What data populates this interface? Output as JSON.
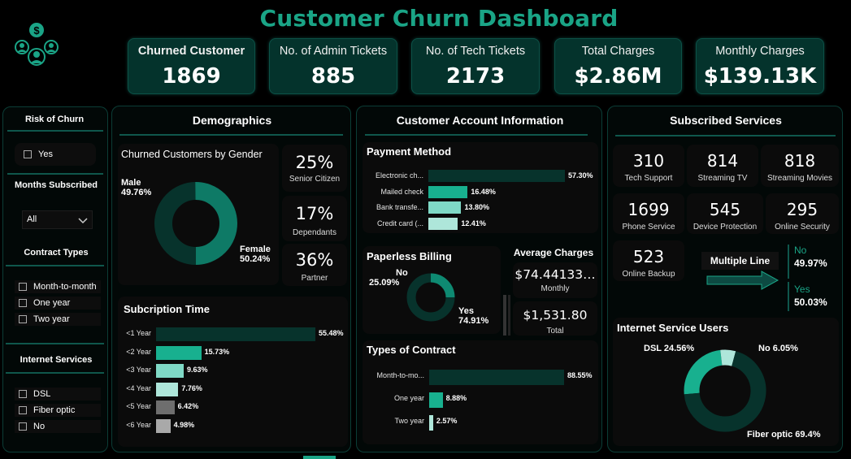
{
  "title": "Customer Churn Dashboard",
  "kpis": [
    {
      "label": "Churned Customer",
      "value": "1869"
    },
    {
      "label": "No. of Admin Tickets",
      "value": "885"
    },
    {
      "label": "No. of Tech Tickets",
      "value": "2173"
    },
    {
      "label": "Total Charges",
      "value": "$2.86M"
    },
    {
      "label": "Monthly Charges",
      "value": "$139.13K"
    }
  ],
  "filters": {
    "risk_label": "Risk of Churn",
    "risk_option": "Yes",
    "months_label": "Months Subscribed",
    "months_value": "All",
    "contract_label": "Contract Types",
    "contract_options": [
      "Month-to-month",
      "One year",
      "Two year"
    ],
    "internet_label": "Internet Services",
    "internet_options": [
      "DSL",
      "Fiber optic",
      "No"
    ]
  },
  "demographics": {
    "title": "Demographics",
    "gender_title": "Churned Customers by Gender",
    "male_label": "Male",
    "male_pct": "49.76%",
    "female_label": "Female",
    "female_pct": "50.24%",
    "stats": [
      {
        "value": "25%",
        "label": "Senior Citizen"
      },
      {
        "value": "17%",
        "label": "Dependants"
      },
      {
        "value": "36%",
        "label": "Partner"
      }
    ],
    "sub_title": "Subcription Time"
  },
  "account": {
    "title": "Customer Account Information",
    "payment_title": "Payment Method",
    "paperless_title": "Paperless Billing",
    "paperless_no_label": "No",
    "paperless_no_pct": "25.09%",
    "paperless_yes_label": "Yes",
    "paperless_yes_pct": "74.91%",
    "avg_title": "Average Charges",
    "avg_monthly_value": "$74.44133…",
    "avg_monthly_label": "Monthly",
    "avg_total_value": "$1,531.80",
    "avg_total_label": "Total",
    "contract_title": "Types of Contract"
  },
  "services": {
    "title": "Subscribed Services",
    "tiles": [
      {
        "value": "310",
        "label": "Tech Support"
      },
      {
        "value": "814",
        "label": "Streaming TV"
      },
      {
        "value": "818",
        "label": "Streaming Movies"
      },
      {
        "value": "1699",
        "label": "Phone Service"
      },
      {
        "value": "545",
        "label": "Device Protection"
      },
      {
        "value": "295",
        "label": "Online Security"
      },
      {
        "value": "523",
        "label": "Online Backup"
      }
    ],
    "multiple_line_label": "Multiple Line",
    "ml_no_label": "No",
    "ml_no_pct": "49.97%",
    "ml_yes_label": "Yes",
    "ml_yes_pct": "50.03%",
    "internet_title": "Internet Service Users",
    "dsl_label": "DSL 24.56%",
    "no_label": "No 6.05%",
    "fiber_label": "Fiber optic 69.4%"
  },
  "colors": {
    "accent": "#1aa486",
    "dark_teal": "#07332c",
    "mid_teal": "#18b08f",
    "light_teal": "#7fd9c6",
    "pale_teal": "#aee6da",
    "grey": "#6e6e6e",
    "light_grey": "#a9a9a9"
  },
  "chart_data": [
    {
      "type": "pie",
      "title": "Churned Customers by Gender",
      "categories": [
        "Male",
        "Female"
      ],
      "values": [
        49.76,
        50.24
      ]
    },
    {
      "type": "bar",
      "title": "Subcription Time",
      "categories": [
        "<1 Year",
        "<2 Year",
        "<3 Year",
        "<4 Year",
        "<5 Year",
        "<6 Year"
      ],
      "values": [
        55.48,
        15.73,
        9.63,
        7.76,
        6.42,
        4.98
      ],
      "labels": [
        "55.48%",
        "15.73%",
        "9.63%",
        "7.76%",
        "6.42%",
        "4.98%"
      ],
      "colors": [
        "#07332c",
        "#18b08f",
        "#7fd9c6",
        "#aee6da",
        "#6e6e6e",
        "#a9a9a9"
      ]
    },
    {
      "type": "bar",
      "title": "Payment Method",
      "categories": [
        "Electronic ch...",
        "Mailed check",
        "Bank transfe...",
        "Credit card (..."
      ],
      "values": [
        57.3,
        16.48,
        13.8,
        12.41
      ],
      "labels": [
        "57.30%",
        "16.48%",
        "13.80%",
        "12.41%"
      ],
      "colors": [
        "#07332c",
        "#18b08f",
        "#7fd9c6",
        "#aee6da"
      ]
    },
    {
      "type": "pie",
      "title": "Paperless Billing",
      "categories": [
        "No",
        "Yes"
      ],
      "values": [
        25.09,
        74.91
      ]
    },
    {
      "type": "bar",
      "title": "Types of Contract",
      "categories": [
        "Month-to-mo...",
        "One year",
        "Two year"
      ],
      "values": [
        88.55,
        8.88,
        2.57
      ],
      "labels": [
        "88.55%",
        "8.88%",
        "2.57%"
      ],
      "colors": [
        "#07332c",
        "#18b08f",
        "#aee6da"
      ]
    },
    {
      "type": "pie",
      "title": "Internet Service Users",
      "categories": [
        "DSL",
        "No",
        "Fiber optic"
      ],
      "values": [
        24.56,
        6.05,
        69.4
      ]
    }
  ]
}
